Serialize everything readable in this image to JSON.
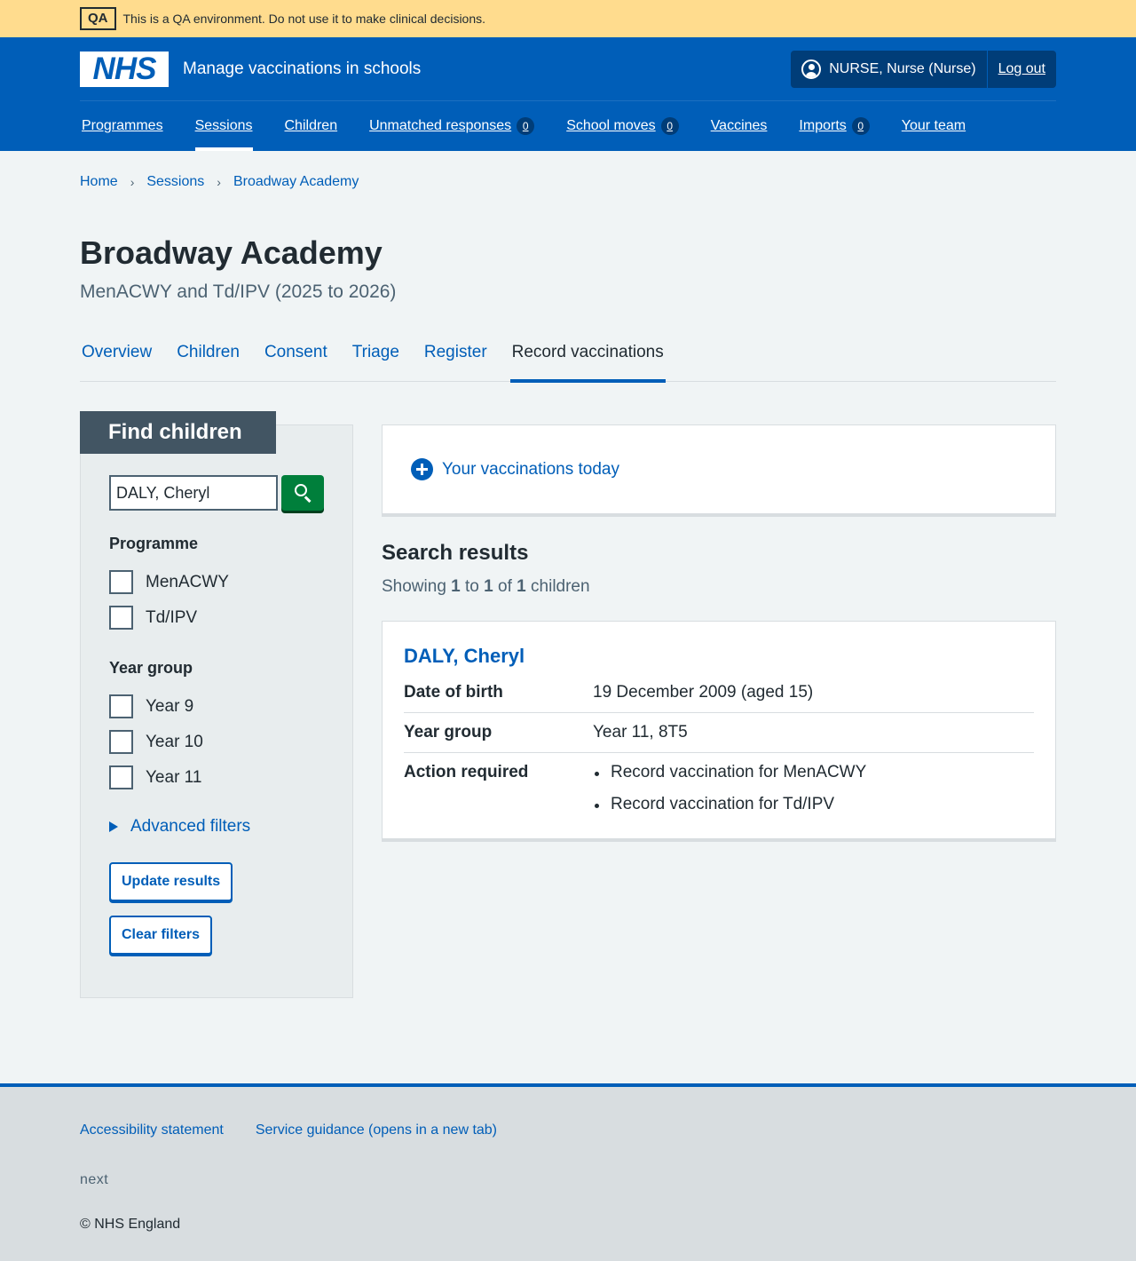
{
  "qa_banner": {
    "tag": "QA",
    "text": "This is a QA environment. Do not use it to make clinical decisions."
  },
  "header": {
    "logo": "NHS",
    "service_name": "Manage vaccinations in schools",
    "account": {
      "user": "NURSE, Nurse (Nurse)",
      "logout": "Log out"
    },
    "nav": [
      {
        "label": "Programmes"
      },
      {
        "label": "Sessions",
        "active": true
      },
      {
        "label": "Children"
      },
      {
        "label": "Unmatched responses",
        "badge": "0"
      },
      {
        "label": "School moves",
        "badge": "0"
      },
      {
        "label": "Vaccines"
      },
      {
        "label": "Imports",
        "badge": "0"
      },
      {
        "label": "Your team"
      }
    ]
  },
  "breadcrumb": [
    "Home",
    "Sessions",
    "Broadway Academy"
  ],
  "page": {
    "title": "Broadway Academy",
    "caption": "MenACWY and Td/IPV (2025 to 2026)"
  },
  "tabs": [
    "Overview",
    "Children",
    "Consent",
    "Triage",
    "Register",
    "Record vaccinations"
  ],
  "active_tab": "Record vaccinations",
  "filters": {
    "heading": "Find children",
    "search_value": "DALY, Cheryl",
    "programme_legend": "Programme",
    "programmes": [
      "MenACWY",
      "Td/IPV"
    ],
    "year_group_legend": "Year group",
    "year_groups": [
      "Year 9",
      "Year 10",
      "Year 11"
    ],
    "advanced": "Advanced filters",
    "update_button": "Update results",
    "clear_button": "Clear filters"
  },
  "vaccinations_today_link": "Your vaccinations today",
  "results": {
    "title": "Search results",
    "count_prefix": "Showing",
    "from": "1",
    "to_word": "to",
    "to": "1",
    "of_word": "of",
    "total": "1",
    "suffix": "children",
    "child": {
      "name": "DALY, Cheryl",
      "dob_label": "Date of birth",
      "dob_value": "19 December 2009 (aged 15)",
      "year_label": "Year group",
      "year_value": "Year 11, 8T5",
      "action_label": "Action required",
      "actions": [
        "Record vaccination for MenACWY",
        "Record vaccination for Td/IPV"
      ]
    }
  },
  "footer": {
    "links": [
      "Accessibility statement",
      "Service guidance (opens in a new tab)"
    ],
    "meta": "next",
    "copyright": "© NHS England"
  }
}
